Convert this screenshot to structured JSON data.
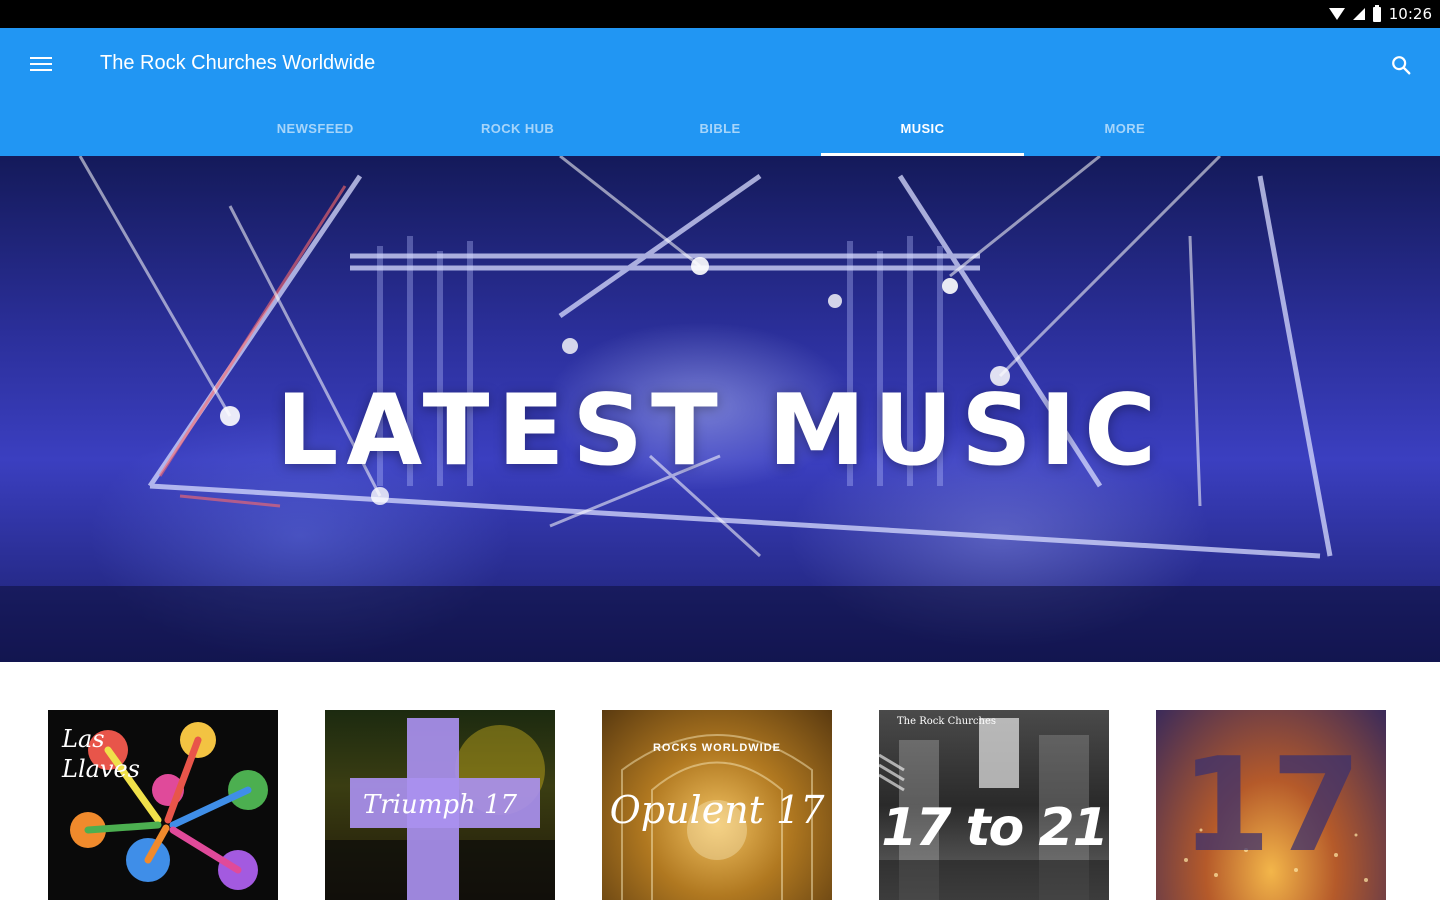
{
  "status_bar": {
    "time": "10:26"
  },
  "app_bar": {
    "title": "The Rock Churches Worldwide",
    "brand_color": "#2196f3"
  },
  "tabs": [
    {
      "label": "NEWSFEED",
      "active": false
    },
    {
      "label": "ROCK HUB",
      "active": false
    },
    {
      "label": "BIBLE",
      "active": false
    },
    {
      "label": "MUSIC",
      "active": true
    },
    {
      "label": "MORE",
      "active": false
    }
  ],
  "hero": {
    "title": "LATEST MUSIC"
  },
  "albums": [
    {
      "title": "Las Llaves"
    },
    {
      "title": "Triumph 17"
    },
    {
      "title": "Opulent 17",
      "header": "ROCKS WORLDWIDE"
    },
    {
      "title": "17 to 21",
      "header": "The Rock Churches"
    },
    {
      "title": "17"
    }
  ]
}
